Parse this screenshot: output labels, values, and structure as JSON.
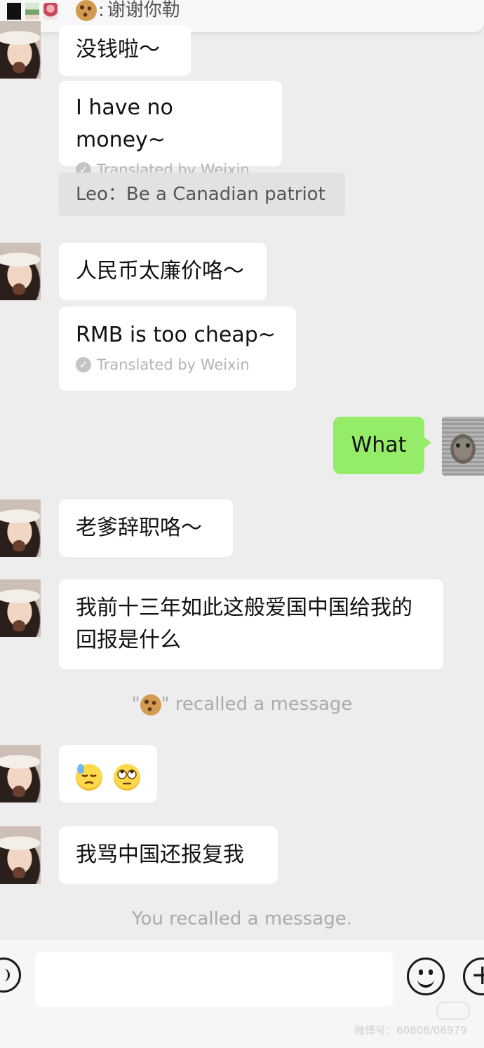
{
  "banner": {
    "text": "谢谢你勒"
  },
  "messages": {
    "m1": "没钱啦～",
    "m1_translation": "I have no money~",
    "translated_by": "Translated by Weixin",
    "quote": "Leo：Be a Canadian patriot",
    "m2": "人民币太廉价咯～",
    "m2_translation": "RMB is too cheap~",
    "me_reply": "What",
    "m3": "老爹辞职咯～",
    "m4_line1": "我前十三年如此这般爱国中国给我的",
    "m4_line2": "回报是什么",
    "recall_other_quote_open": "\"",
    "recall_other_quote_close": "\"",
    "recall_other_suffix": "recalled a message",
    "m6": "我骂中国还报复我",
    "recall_self": "You recalled a message."
  },
  "icons": {
    "translate_check": "✓",
    "plus": "+"
  },
  "watermark": "微博号：60808/06979",
  "colors": {
    "chat_bg": "#ededed",
    "bubble_other": "#ffffff",
    "bubble_self": "#95ec69",
    "system_text": "#ababab"
  }
}
